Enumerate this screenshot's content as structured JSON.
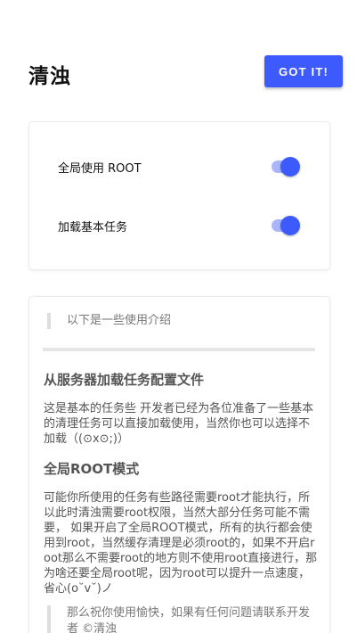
{
  "header": {
    "title": "清浊",
    "got_it_label": "GOT IT!"
  },
  "settings": {
    "items": [
      {
        "label": "全局使用 ROOT",
        "enabled": true
      },
      {
        "label": "加载基本任务",
        "enabled": true
      }
    ]
  },
  "doc": {
    "intro_quote": "以下是一些使用介绍",
    "sections": [
      {
        "heading": "从服务器加载任务配置文件",
        "body": "这是基本的任务些 开发者已经为各位准备了一些基本的清理任务可以直接加载使用，当然你也可以选择不加载（(⊙x⊙;)）"
      },
      {
        "heading": "全局ROOT模式",
        "body": "可能你所使用的任务有些路径需要root才能执行，所以此时清浊需要root权限，当然大部分任务可能不需要， 如果开启了全局ROOT模式，所有的执行都会使用到root，当然缓存清理是必须root的，如果不开启root那么不需要root的地方则不使用root直接进行，那为啥还要全局root呢，因为root可以提升一点速度，省心(o˘v˘)ノ"
      }
    ],
    "closing_quote": "那么祝你使用愉快，如果有任何问题请联系开发者 ©清浊"
  },
  "colors": {
    "accent": "#3d5afe",
    "switch_track": "#a9b6fd"
  }
}
